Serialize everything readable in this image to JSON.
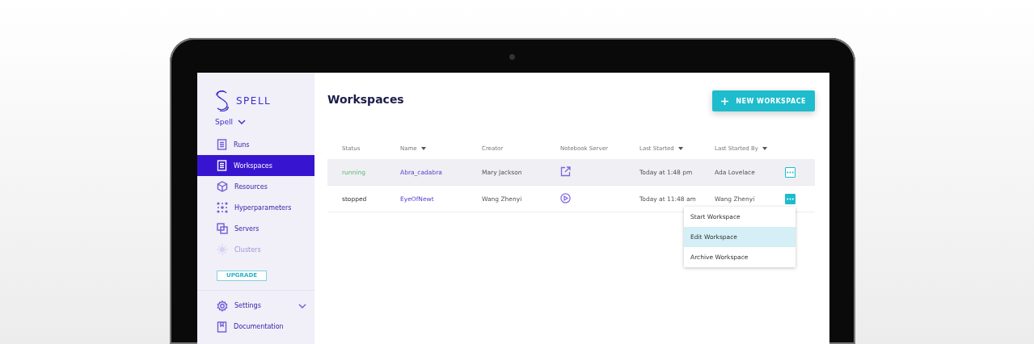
{
  "sidebar": {
    "brand": "SPELL",
    "org": "Spell",
    "items": [
      {
        "label": "Runs",
        "selected": false,
        "disabled": false
      },
      {
        "label": "Workspaces",
        "selected": true,
        "disabled": false
      },
      {
        "label": "Resources",
        "selected": false,
        "disabled": false
      },
      {
        "label": "Hyperparameters",
        "selected": false,
        "disabled": false
      },
      {
        "label": "Servers",
        "selected": false,
        "disabled": false
      },
      {
        "label": "Clusters",
        "selected": false,
        "disabled": true
      }
    ],
    "upgrade": "UPGRADE",
    "bottom_items": [
      {
        "label": "Settings",
        "expandable": true
      },
      {
        "label": "Documentation",
        "expandable": false
      }
    ]
  },
  "page": {
    "title": "Workspaces",
    "new_button": "NEW WORKSPACE"
  },
  "table": {
    "columns": [
      {
        "label": "Status",
        "sortable": false
      },
      {
        "label": "Name",
        "sortable": true
      },
      {
        "label": "Creator",
        "sortable": false
      },
      {
        "label": "Notebook Server",
        "sortable": false
      },
      {
        "label": "Last Started",
        "sortable": true
      },
      {
        "label": "Last Started By",
        "sortable": true
      }
    ],
    "rows": [
      {
        "status": "running",
        "name": "Abra_cadabra",
        "creator": "Mary Jackson",
        "last_started": "Today at 1:48 pm",
        "last_started_by": "Ada Lovelace",
        "highlighted": true,
        "menu_open": false
      },
      {
        "status": "stopped",
        "name": "EyeOfNewt",
        "creator": "Wang Zhenyi",
        "last_started": "Today at 11:48 am",
        "last_started_by": "Wang Zhenyi",
        "highlighted": false,
        "menu_open": true
      }
    ]
  },
  "row_menu": {
    "items": [
      {
        "label": "Start Workspace",
        "selected": false
      },
      {
        "label": "Edit Workspace",
        "selected": true
      },
      {
        "label": "Archive Workspace",
        "selected": false
      }
    ]
  }
}
